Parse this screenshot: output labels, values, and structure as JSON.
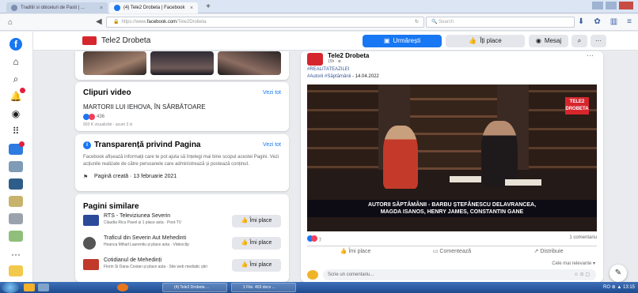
{
  "browser": {
    "tabs": [
      {
        "label": "Traditii si obiceiuri de Pasti | ..."
      },
      {
        "label": "(4) Tele2 Drobeta | Facebook"
      }
    ],
    "new_tab": "+",
    "url_prefix": "https://www.",
    "url_domain": "facebook.com",
    "url_rest": "/Tele2Drobeta",
    "search_placeholder": "Search"
  },
  "page": {
    "name": "Tele2 Drobeta",
    "follow_label": "Urmărești",
    "like_label": "Îți place",
    "message_label": "Mesaj",
    "more_label": "···"
  },
  "videos": {
    "title": "Clipuri video",
    "see_all": "Vezi tot",
    "video_title": "MARTORII LUI IEHOVA, ÎN SĂRBĂTOARE",
    "reaction_count": "436",
    "views": "903 K vizualizări · acum 3 zi"
  },
  "transparency": {
    "title": "Transparență privind Pagina",
    "see_all": "Vezi tot",
    "description": "Facebook afișează informații care te pot ajuta să înțelegi mai bine scopul acestei Pagini. Vezi acțiunile realizate de către persoanele care administrează și postează conținut.",
    "created": "Pagină creată · 13 februarie 2021"
  },
  "similar": {
    "title": "Pagini similare",
    "like_label": "Îmi place",
    "pages": [
      {
        "name": "RTS - Televiziunea Severin",
        "sub": "Claudia Ricu Pavel și 1 place asta · Post-TV",
        "color": "#2c4a9a"
      },
      {
        "name": "Traficul din Severin Aut Mehedinti",
        "sub": "Hoanca Mihail Laurentiu și place asta · Videoclip",
        "color": "#555555"
      },
      {
        "name": "Cotidianul de Mehedinți",
        "sub": "Florin Si Dana Costan și place asta · Site web mediatic știri",
        "color": "#c0392b"
      }
    ]
  },
  "post": {
    "author": "Tele2 Drobeta",
    "time": "15h · ⊕",
    "hashtag1": "#REALITATEAZILEI",
    "hashtag2": "#Autorii #Săptămânii",
    "date_suffix": " - 14.04.2022",
    "video_logo_1": "TELE",
    "video_logo_2": "DROBETA",
    "caption_line1": "AUTORII SĂPTĂMÂNII - BARBU ȘTEFĂNESCU DELAVRANCEA,",
    "caption_line2": "MAGDA ISANOS, HENRY JAMES, CONSTANTIN GANE",
    "reaction_count": "7",
    "comments": "1 comentariu",
    "like_action": "Îmi place",
    "comment_action": "Comentează",
    "share_action": "Distribuie",
    "relevance": "Cele mai relevante ▾",
    "comment_placeholder": "Scrie un comentariu...",
    "comment_icons": "☺ ⊙ ▢"
  },
  "taskbar": {
    "tasks": [
      "(4) Tele2 Drobeta ...",
      "1 File. 403 docx ..."
    ],
    "tray": "RO ⊕ ▲ 13:15"
  },
  "colors": {
    "facebook_blue": "#1877f2",
    "brand_red": "#d6262d",
    "page_bg": "#e9ebee"
  }
}
